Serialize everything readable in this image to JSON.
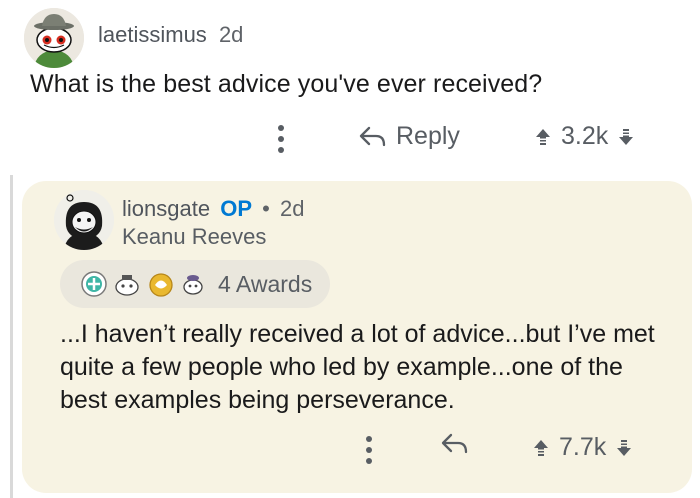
{
  "top_comment": {
    "username": "laetissimus",
    "age": "2d",
    "body": "What is the best advice you've ever received?",
    "reply_label": "Reply",
    "score": "3.2k"
  },
  "reply_comment": {
    "username": "lionsgate",
    "op_badge": "OP",
    "separator": "•",
    "age": "2d",
    "flair": "Keanu Reeves",
    "awards_label": "4 Awards",
    "body": "...I haven’t really received a lot of advice...but I’ve met quite a few people who led by example...one of the best examples being perseverance.",
    "score": "7.7k"
  },
  "icons": [
    "overflow-dots-icon",
    "reply-arrow-icon",
    "upvote-icon",
    "downvote-icon",
    "award-icon"
  ],
  "colors": {
    "accent": "#0079d3",
    "card_bg": "#f7f3e3",
    "text": "#1a1a1b",
    "muted": "#585d63"
  }
}
